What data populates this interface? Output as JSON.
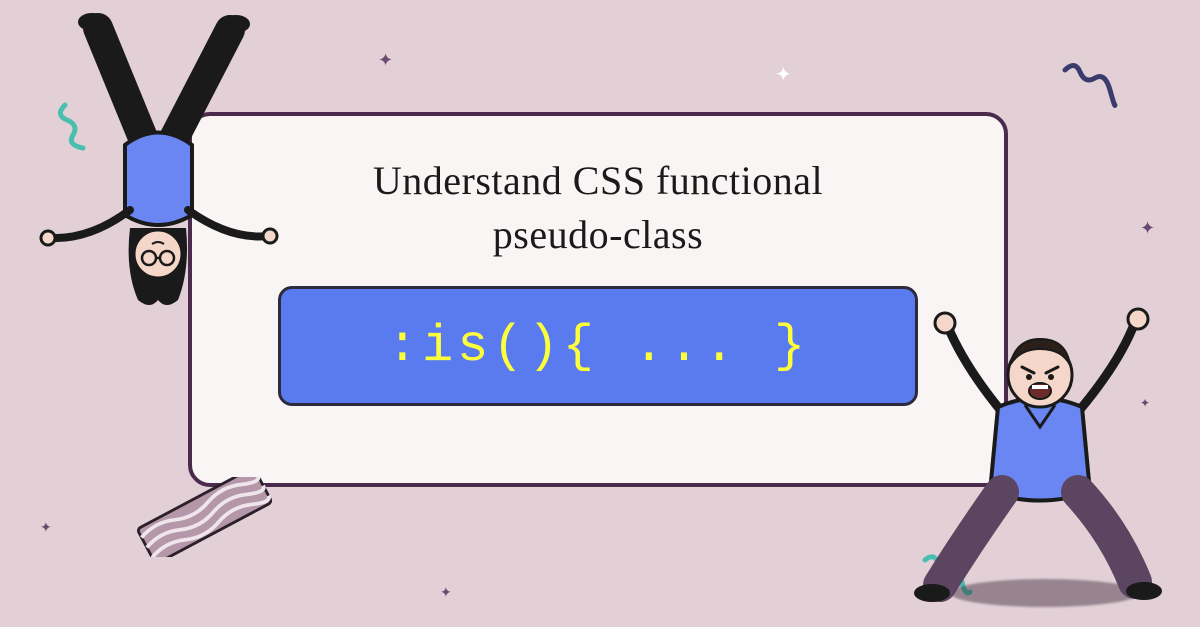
{
  "card": {
    "title_line1": "Understand CSS functional",
    "title_line2": "pseudo-class",
    "code": ":is(){ ... }"
  },
  "decor": {
    "ribbon_color": "#9b7a8e",
    "squiggle_color": "#4abfb0",
    "navy_squiggle": "#3b3c6e",
    "accent": "#5a7bf0"
  }
}
